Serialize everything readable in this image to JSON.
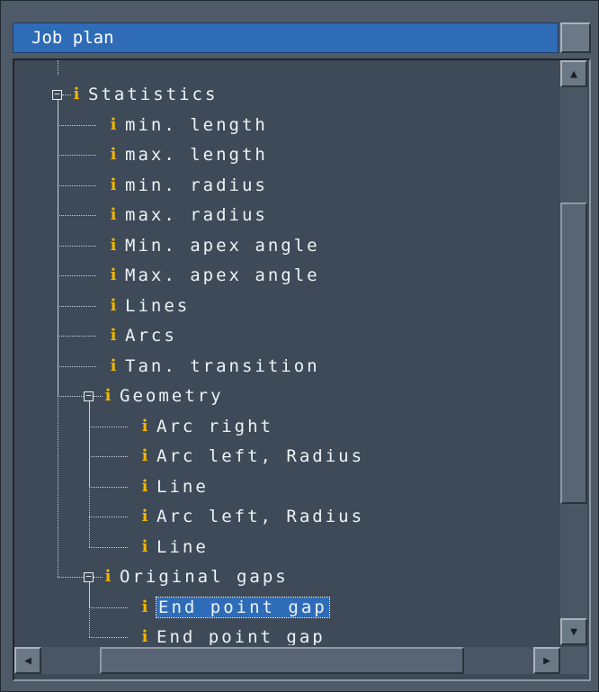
{
  "window": {
    "title": "Job plan"
  },
  "tree": {
    "nodes": [
      {
        "label": "Statistics",
        "level": 0,
        "expandable": true,
        "expanded": true
      },
      {
        "label": "min. length",
        "level": 1
      },
      {
        "label": "max. length",
        "level": 1
      },
      {
        "label": "min. radius",
        "level": 1
      },
      {
        "label": "max. radius",
        "level": 1
      },
      {
        "label": "Min. apex angle",
        "level": 1
      },
      {
        "label": "Max. apex angle",
        "level": 1
      },
      {
        "label": "Lines",
        "level": 1
      },
      {
        "label": "Arcs",
        "level": 1
      },
      {
        "label": "Tan. transition",
        "level": 1
      },
      {
        "label": "Geometry",
        "level": 1,
        "expandable": true,
        "expanded": true
      },
      {
        "label": "Arc right",
        "level": 2
      },
      {
        "label": "Arc left, Radius",
        "level": 2
      },
      {
        "label": "Line",
        "level": 2
      },
      {
        "label": "Arc left, Radius",
        "level": 2
      },
      {
        "label": "Line",
        "level": 2
      },
      {
        "label": "Original gaps",
        "level": 1,
        "expandable": true,
        "expanded": true
      },
      {
        "label": "End point gap",
        "level": 2,
        "selected": true
      },
      {
        "label": "End point gap",
        "level": 2
      }
    ]
  },
  "icons": {
    "node_icon": "info-icon",
    "toggle": "minus-box-icon",
    "scroll_up": "arrow-up-icon",
    "scroll_down": "arrow-down-icon",
    "scroll_left": "arrow-left-icon",
    "scroll_right": "arrow-right-icon"
  },
  "glyphs": {
    "info": "i",
    "minus": "−",
    "up": "▲",
    "down": "▼",
    "left": "◀",
    "right": "▶"
  },
  "colors": {
    "title_bar": "#2f6cb8",
    "panel_bg": "#3e4a58",
    "info_icon": "#f2b500",
    "selection": "#2f6cb8",
    "text": "#eef2f6"
  }
}
